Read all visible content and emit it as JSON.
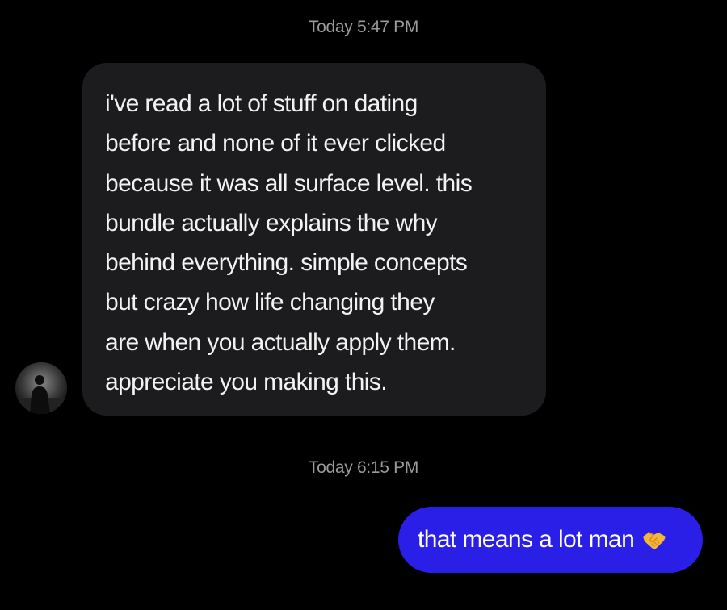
{
  "conversation": {
    "timestamps": [
      "Today 5:47 PM",
      "Today 6:15 PM"
    ],
    "incoming_message": {
      "lines": [
        "i've read a lot of stuff on dating",
        "before and none of it ever clicked",
        "because it was all surface level. this",
        "bundle actually explains the why",
        "behind everything. simple concepts",
        "but crazy how life changing they",
        "are when you actually apply them.",
        "appreciate you making this."
      ],
      "bubble_color": "#1c1c1e",
      "avatar_icon": "person-silhouette-avatar"
    },
    "outgoing_message": {
      "text": "that means a lot man",
      "emoji_icon": "handshake-icon",
      "bubble_color": "#2a1fe6"
    }
  }
}
